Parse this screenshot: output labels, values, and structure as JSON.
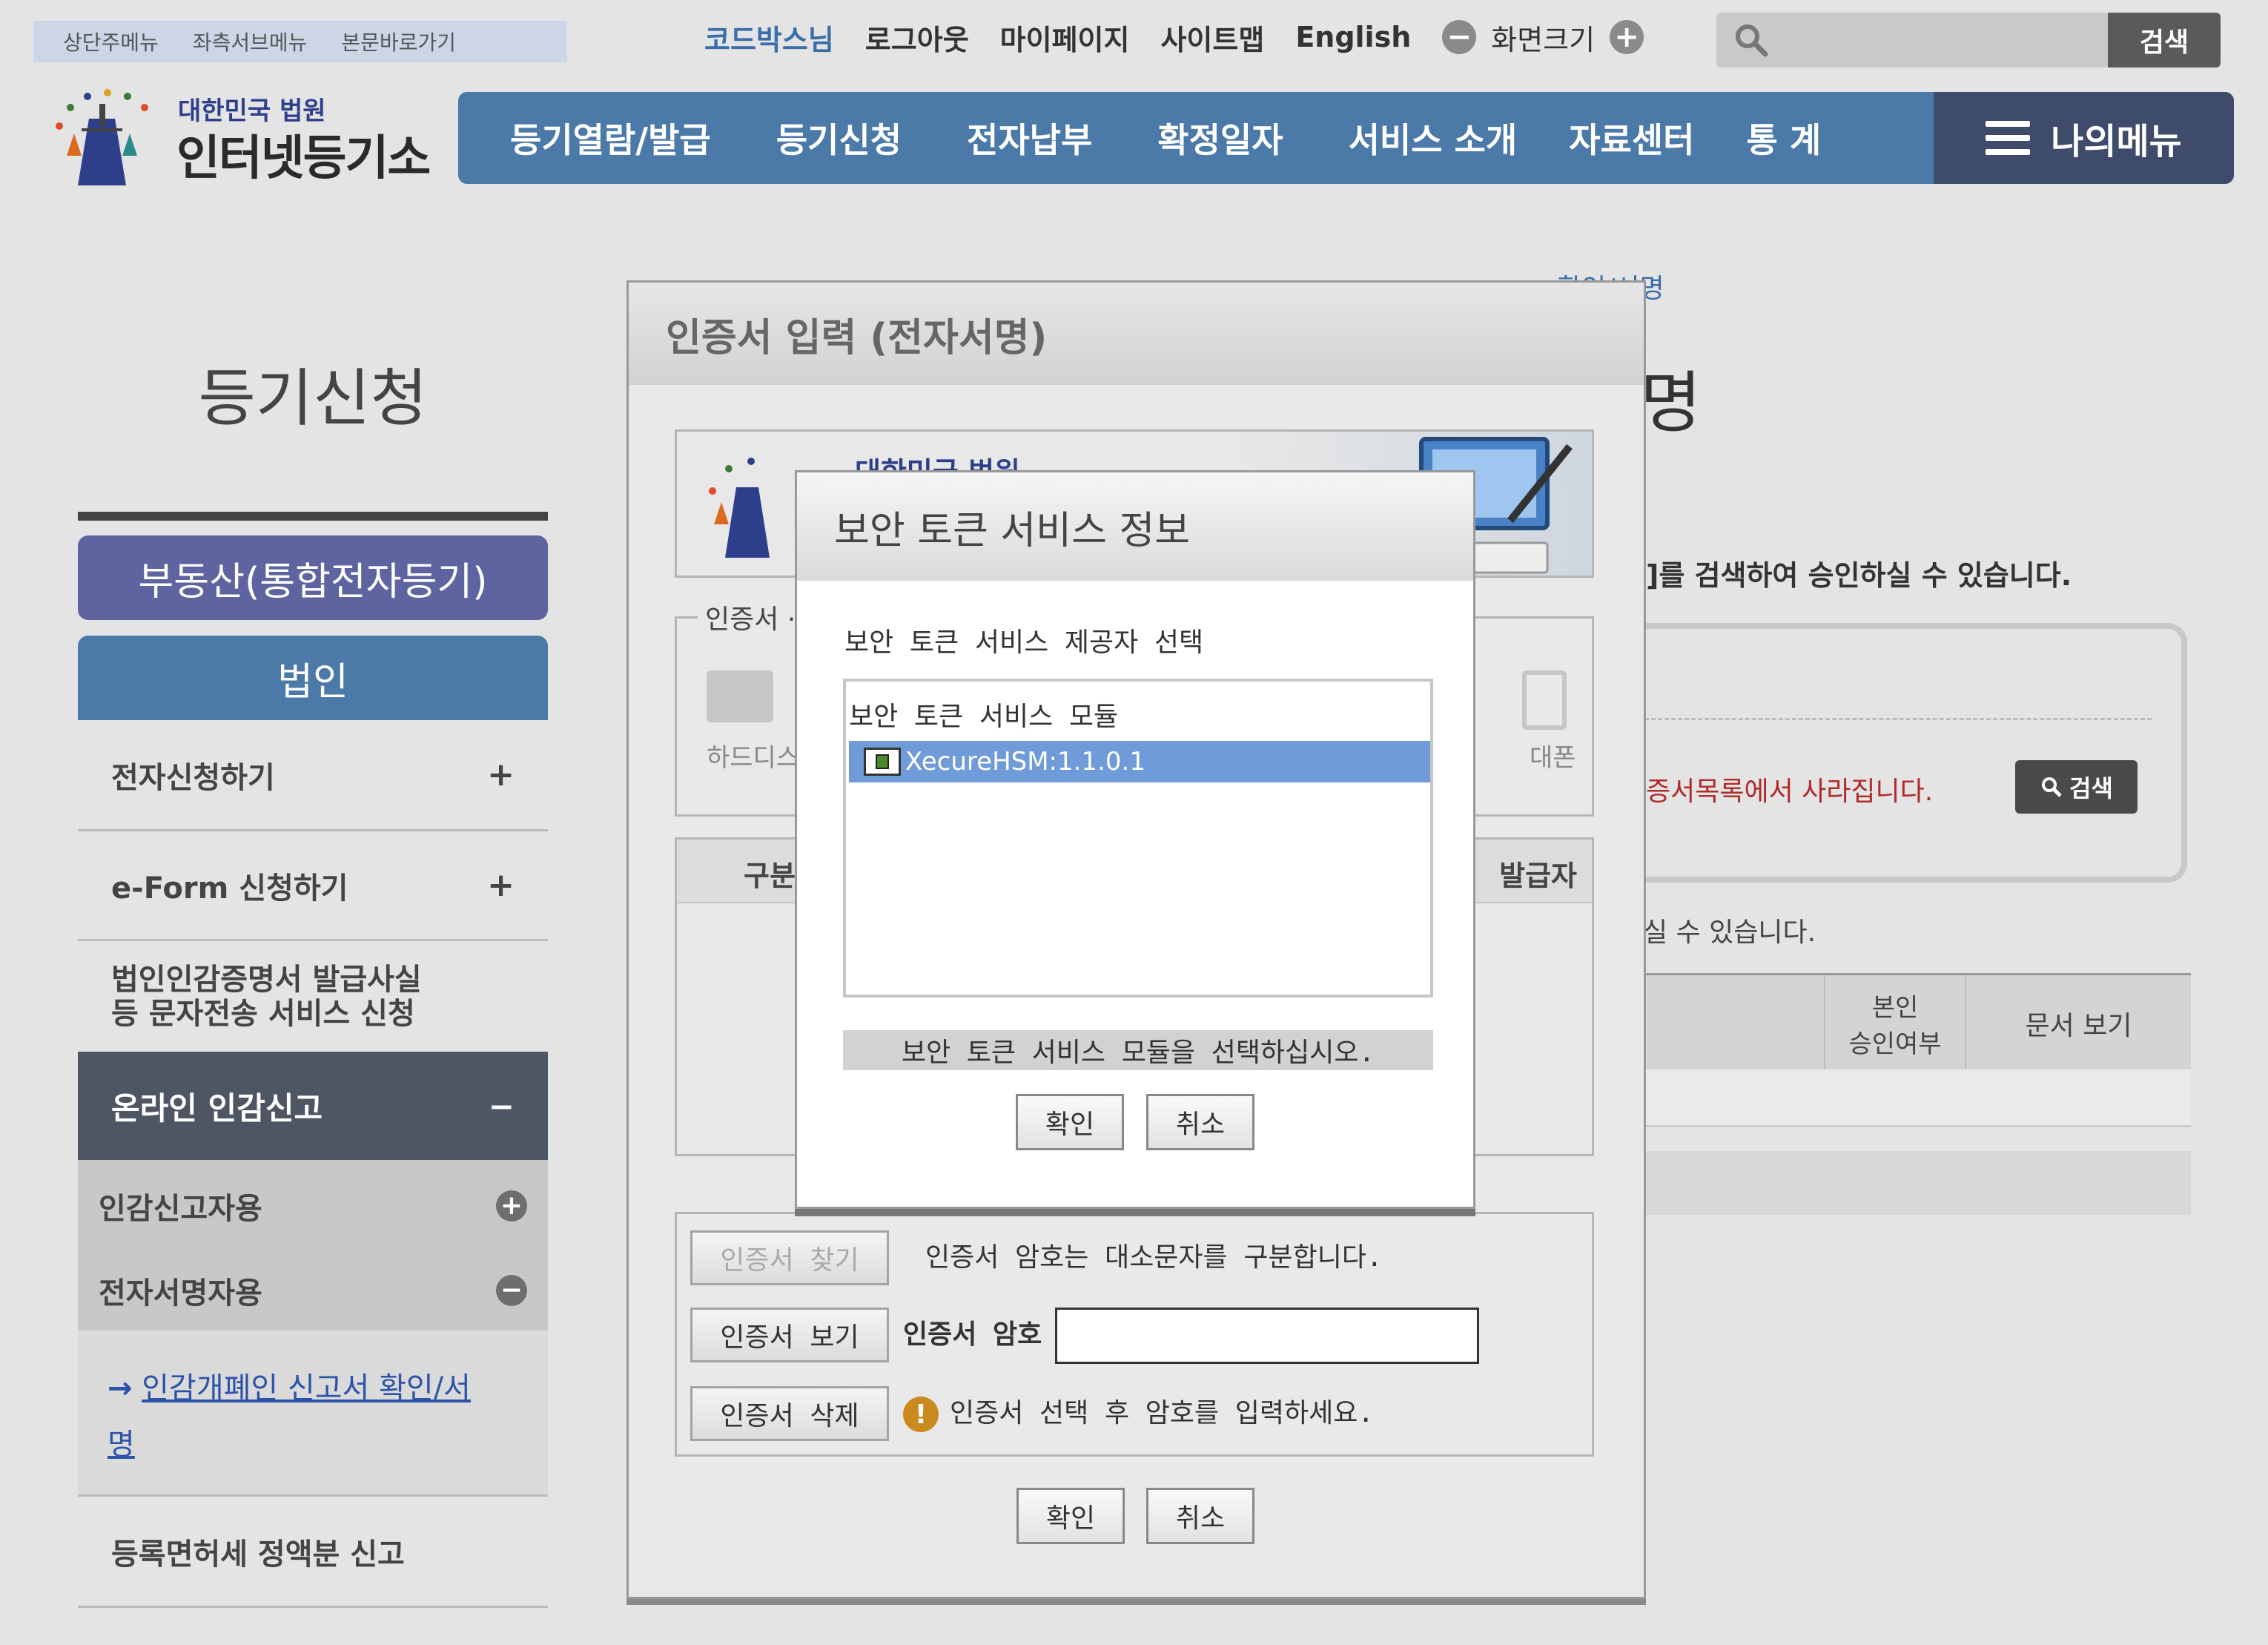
{
  "skip_links": [
    "상단주메뉴",
    "좌측서브메뉴",
    "본문바로가기"
  ],
  "util": {
    "user": "코드박스님",
    "logout": "로그아웃",
    "mypage": "마이페이지",
    "sitemap": "사이트맵",
    "english": "English",
    "zoom_minus": "−",
    "zoom_label": "화면크기",
    "zoom_plus": "+",
    "search_placeholder": "",
    "search_button": "검색"
  },
  "logo": {
    "line1": "대한민국 법원",
    "line2": "인터넷등기소"
  },
  "gnb": {
    "items": [
      "등기열람/발급",
      "등기신청",
      "전자납부",
      "확정일자",
      "서비스 소개",
      "자료센터",
      "통 계"
    ],
    "my_menu": "나의메뉴"
  },
  "sidebar": {
    "title": "등기신청",
    "btn_realestate": "부동산(통합전자등기)",
    "btn_corp": "법인",
    "items": [
      {
        "label": "전자신청하기",
        "toggle": "+"
      },
      {
        "label": "e-Form 신청하기",
        "toggle": "+"
      },
      {
        "label_line1": "법인인감증명서 발급사실",
        "label_line2": "등 문자전송 서비스 신청"
      }
    ],
    "active_group": {
      "label": "온라인 인감신고",
      "toggle": "−"
    },
    "sub_items": [
      {
        "label": "인감신고자용",
        "toggle": "+"
      },
      {
        "label": "전자서명자용",
        "toggle": "−"
      }
    ],
    "sub_link_arrow": "→",
    "sub_link_line1": "인감개폐인 신고서 확인/서",
    "sub_link_line2": "명",
    "last_item": "등록면허세 정액분 신고"
  },
  "background": {
    "breadcrumb_tail": "확인/서명",
    "page_title_tail": "명",
    "desc1": "]를 검색하여 승인하실 수 있습니다.",
    "warning": "증서목록에서 사라집니다.",
    "search_button": "검색",
    "desc2": "실 수 있습니다.",
    "col_approval_line1": "본인",
    "col_approval_line2": "승인여부",
    "col_doc": "문서 보기"
  },
  "cert_dialog": {
    "title": "인증서 입력 (전자서명)",
    "banner_text": "대한민국 법원",
    "storage_legend": "인증서 ·",
    "storage_hdd": "하드디스",
    "storage_phone": "대폰",
    "table_col1": "구분",
    "table_col_last": "발급자",
    "btn_find": "인증서 찾기",
    "case_note": "인증서 암호는 대소문자를 구분합니다.",
    "btn_view": "인증서 보기",
    "pw_label": "인증서 암호",
    "pw_value": "",
    "btn_delete": "인증서 삭제",
    "hint_icon": "!",
    "hint": "인증서 선택 후 암호를 입력하세요.",
    "ok": "확인",
    "cancel": "취소"
  },
  "token_dialog": {
    "title": "보안 토큰 서비스 정보",
    "prompt": "보안 토큰 서비스 제공자 선택",
    "list_header": "보안 토큰 서비스 모듈",
    "modules": [
      "XecureHSM:1.1.0.1"
    ],
    "status": "보안 토큰 서비스 모듈을 선택하십시오.",
    "ok": "확인",
    "cancel": "취소"
  },
  "colors": {
    "nav_blue": "#4b7aa8",
    "nav_dark": "#3e4b6b",
    "realestate_purple": "#5d64a0",
    "selection_blue": "#6f9bd8",
    "link_blue": "#2d53a8",
    "warning_red": "#b02a2a"
  }
}
